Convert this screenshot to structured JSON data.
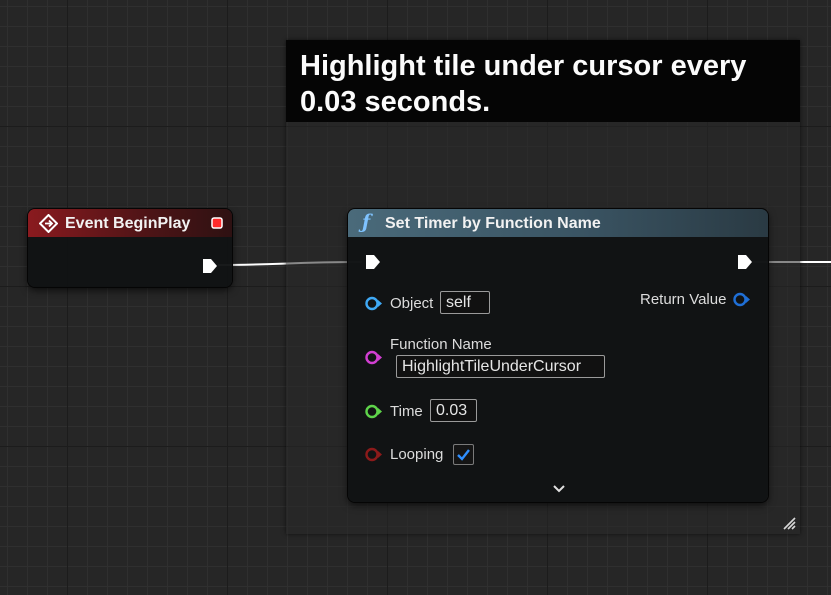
{
  "comment": {
    "text_line1": "Highlight tile under cursor every",
    "text_line2": "0.03 seconds."
  },
  "event_node": {
    "title": "Event BeginPlay",
    "icon": "event-diamond-icon",
    "header_color": "#8a1a1f"
  },
  "function_node": {
    "title": "Set Timer by Function Name",
    "icon": "function-f-icon",
    "header_color": "#4a6a7a",
    "pins": {
      "object": {
        "label": "Object",
        "value": "self",
        "color": "#3fa9f5"
      },
      "function_name": {
        "label": "Function Name",
        "value": "HighlightTileUnderCursor",
        "color": "#d23fd2"
      },
      "time": {
        "label": "Time",
        "value": "0.03",
        "color": "#5ed44a"
      },
      "looping": {
        "label": "Looping",
        "checked": true,
        "color": "#8c1a1a"
      },
      "return_value": {
        "label": "Return Value",
        "color": "#1f6fd6"
      }
    },
    "expand_icon": "chevron-down-icon"
  },
  "colors": {
    "background": "#262626",
    "exec_wire": "#ffffff",
    "check_mark": "#2f8fff"
  }
}
